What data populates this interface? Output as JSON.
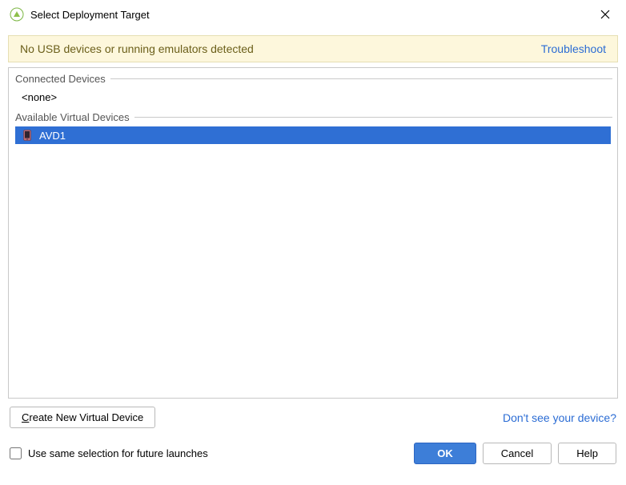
{
  "window": {
    "title": "Select Deployment Target"
  },
  "banner": {
    "message": "No USB devices or running emulators detected",
    "troubleshoot": "Troubleshoot"
  },
  "groups": {
    "connected_label": "Connected Devices",
    "connected_none": "<none>",
    "avd_label": "Available Virtual Devices"
  },
  "devices": {
    "selected": {
      "name": "AVD1"
    }
  },
  "actions": {
    "create_new_prefix": "C",
    "create_new_rest": "reate New Virtual Device",
    "dont_see": "Don't see your device?",
    "checkbox_label": "Use same selection for future launches",
    "ok": "OK",
    "cancel": "Cancel",
    "help": "Help"
  }
}
